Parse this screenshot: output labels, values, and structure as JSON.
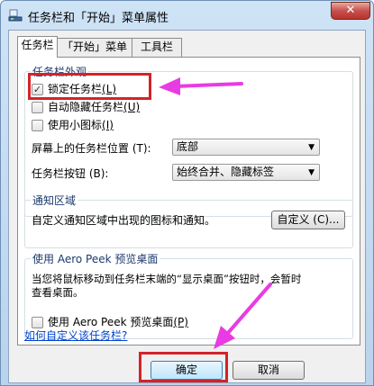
{
  "window": {
    "title": "任务栏和「开始」菜单属性",
    "close_symbol": "✕"
  },
  "tabs": [
    {
      "label": "任务栏",
      "active": true
    },
    {
      "label": "「开始」菜单",
      "active": false
    },
    {
      "label": "工具栏",
      "active": false
    }
  ],
  "taskbar_appearance": {
    "legend": "任务栏外观",
    "lock_taskbar": {
      "label": "锁定任务栏",
      "key": "(L)",
      "checked": true
    },
    "auto_hide": {
      "label": "自动隐藏任务栏",
      "key": "(U)",
      "checked": false
    },
    "small_icons": {
      "label": "使用小图标",
      "key": "(I)",
      "checked": false
    },
    "location": {
      "label": "屏幕上的任务栏位置 (T):",
      "value": "底部"
    },
    "buttons": {
      "label": "任务栏按钮 (B):",
      "value": "始终合并、隐藏标签"
    }
  },
  "notification_area": {
    "legend": "通知区域",
    "description": "自定义通知区域中出现的图标和通知。",
    "customize_label": "自定义 (C)..."
  },
  "aero_peek": {
    "legend": "使用 Aero Peek 预览桌面",
    "description_line1": "当您将鼠标移动到任务栏末端的“显示桌面”按钮时，会暂时",
    "description_line2": "查看桌面。",
    "checkbox": {
      "label": "使用 Aero Peek 预览桌面",
      "key": "(P)",
      "checked": false
    }
  },
  "help_link": "如何自定义该任务栏?",
  "footer": {
    "ok_label": "确定",
    "cancel_label": "取消"
  },
  "colors": {
    "highlight": "#d2232a",
    "arrow": "#e93be3",
    "link": "#0044cc"
  }
}
